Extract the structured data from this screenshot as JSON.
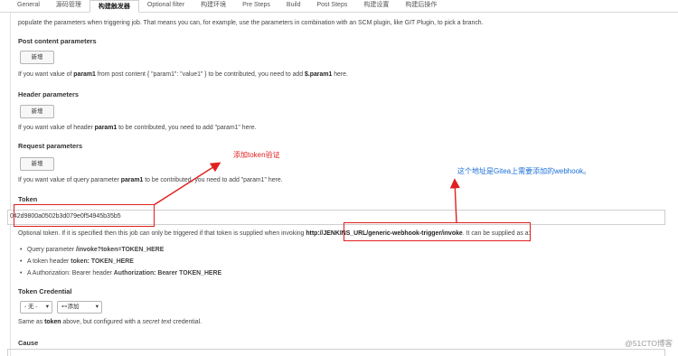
{
  "tabs": [
    {
      "label": "General",
      "active": false
    },
    {
      "label": "源码管理",
      "active": false
    },
    {
      "label": "构建触发器",
      "active": true
    },
    {
      "label": "Optional filter",
      "active": false
    },
    {
      "label": "构建环境",
      "active": false
    },
    {
      "label": "Pre Steps",
      "active": false
    },
    {
      "label": "Build",
      "active": false
    },
    {
      "label": "Post Steps",
      "active": false
    },
    {
      "label": "构建设置",
      "active": false
    },
    {
      "label": "构建后操作",
      "active": false
    }
  ],
  "intro": "populate the parameters when triggering job. That means you can, for example, use the parameters in combination with an SCM plugin, like GIT Plugin, to pick a branch.",
  "post_content": {
    "label": "Post content parameters",
    "add_button": "新增",
    "help_pre": "If you want value of ",
    "help_param": "param1",
    "help_mid": " from post content { \"param1\": \"value1\" } to be contributed, you need to add ",
    "help_param2": "$.param1",
    "help_post": " here."
  },
  "header_params": {
    "label": "Header parameters",
    "add_button": "新增",
    "help_pre": "If you want value of header ",
    "help_param": "param1",
    "help_post": " to be contributed, you need to add \"param1\" here."
  },
  "request_params": {
    "label": "Request parameters",
    "add_button": "新增",
    "help_pre": "If you want value of query parameter ",
    "help_param": "param1",
    "help_post": " to be contributed, you need to add \"param1\" here."
  },
  "token": {
    "label": "Token",
    "value": "042d9800a0502b3d079e0f54945b35b5",
    "help_pre": "Optional token. If it is specified then this job can only be triggered if that token is supplied when invoking ",
    "url": "http://JENKINS_URL/generic-webhook-trigger/invoke",
    "help_post": ". It can be supplied as a:",
    "bullets": [
      {
        "text": "Query parameter ",
        "bold": "/invoke?token=TOKEN_HERE"
      },
      {
        "text": "A token header ",
        "bold": "token: TOKEN_HERE"
      },
      {
        "text": "A Authorization: Bearer header ",
        "bold": "Authorization: Bearer TOKEN_HERE"
      }
    ]
  },
  "token_credential": {
    "label": "Token Credential",
    "select_value": "- 无 -",
    "add_button": "添加",
    "help_pre": "Same as ",
    "help_bold": "token",
    "help_mid": " above, but configured with a ",
    "help_italic": "secret text",
    "help_post": " credential."
  },
  "cause": {
    "label": "Cause"
  },
  "annotations": {
    "red": "添加token验证",
    "blue": "这个地址是Gitea上需要添加的webhook。",
    "red_color": "#e02020",
    "blue_color": "#1a6fd8"
  },
  "watermark": "@51CTO博客"
}
